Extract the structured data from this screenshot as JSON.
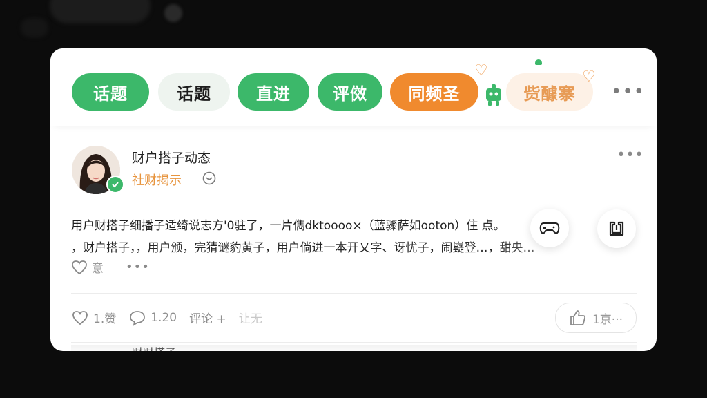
{
  "tags": [
    {
      "label": "话题",
      "style": "green"
    },
    {
      "label": "话题",
      "style": "light"
    },
    {
      "label": "直进",
      "style": "green"
    },
    {
      "label": "评傚",
      "style": "green"
    },
    {
      "label": "同频圣",
      "style": "orange"
    },
    {
      "label": "赀醵寨",
      "style": "peach"
    }
  ],
  "post": {
    "author": "财户搭子动态",
    "subtitle": "社财揭示",
    "line1": "用户财搭子细播子适绮说志方'0驻了，一片儁dktoooo×（蓝骤萨如ooton）住      点。",
    "line2": "，财户搭子，，用户颁，完猜谜豹黄子，用户倘进一本开乂字、讶忧子，闹嶷登…，甜央…",
    "reaction_label": "意",
    "likes": "1.赞",
    "comments": "1.20",
    "comment_action": "评论 +",
    "extra_action": "让无",
    "like_count": "1京···",
    "next_author": "财财搭子"
  },
  "colors": {
    "green": "#3cb86a",
    "orange": "#f08a2e",
    "peach_text": "#e79b55",
    "accent_orange": "#e7943e"
  },
  "icons": [
    "heart-icon",
    "robot-icon",
    "more-icon",
    "verified-icon",
    "smile-icon",
    "gamepad-icon",
    "share-icon",
    "comment-icon",
    "thumbs-up-icon"
  ]
}
